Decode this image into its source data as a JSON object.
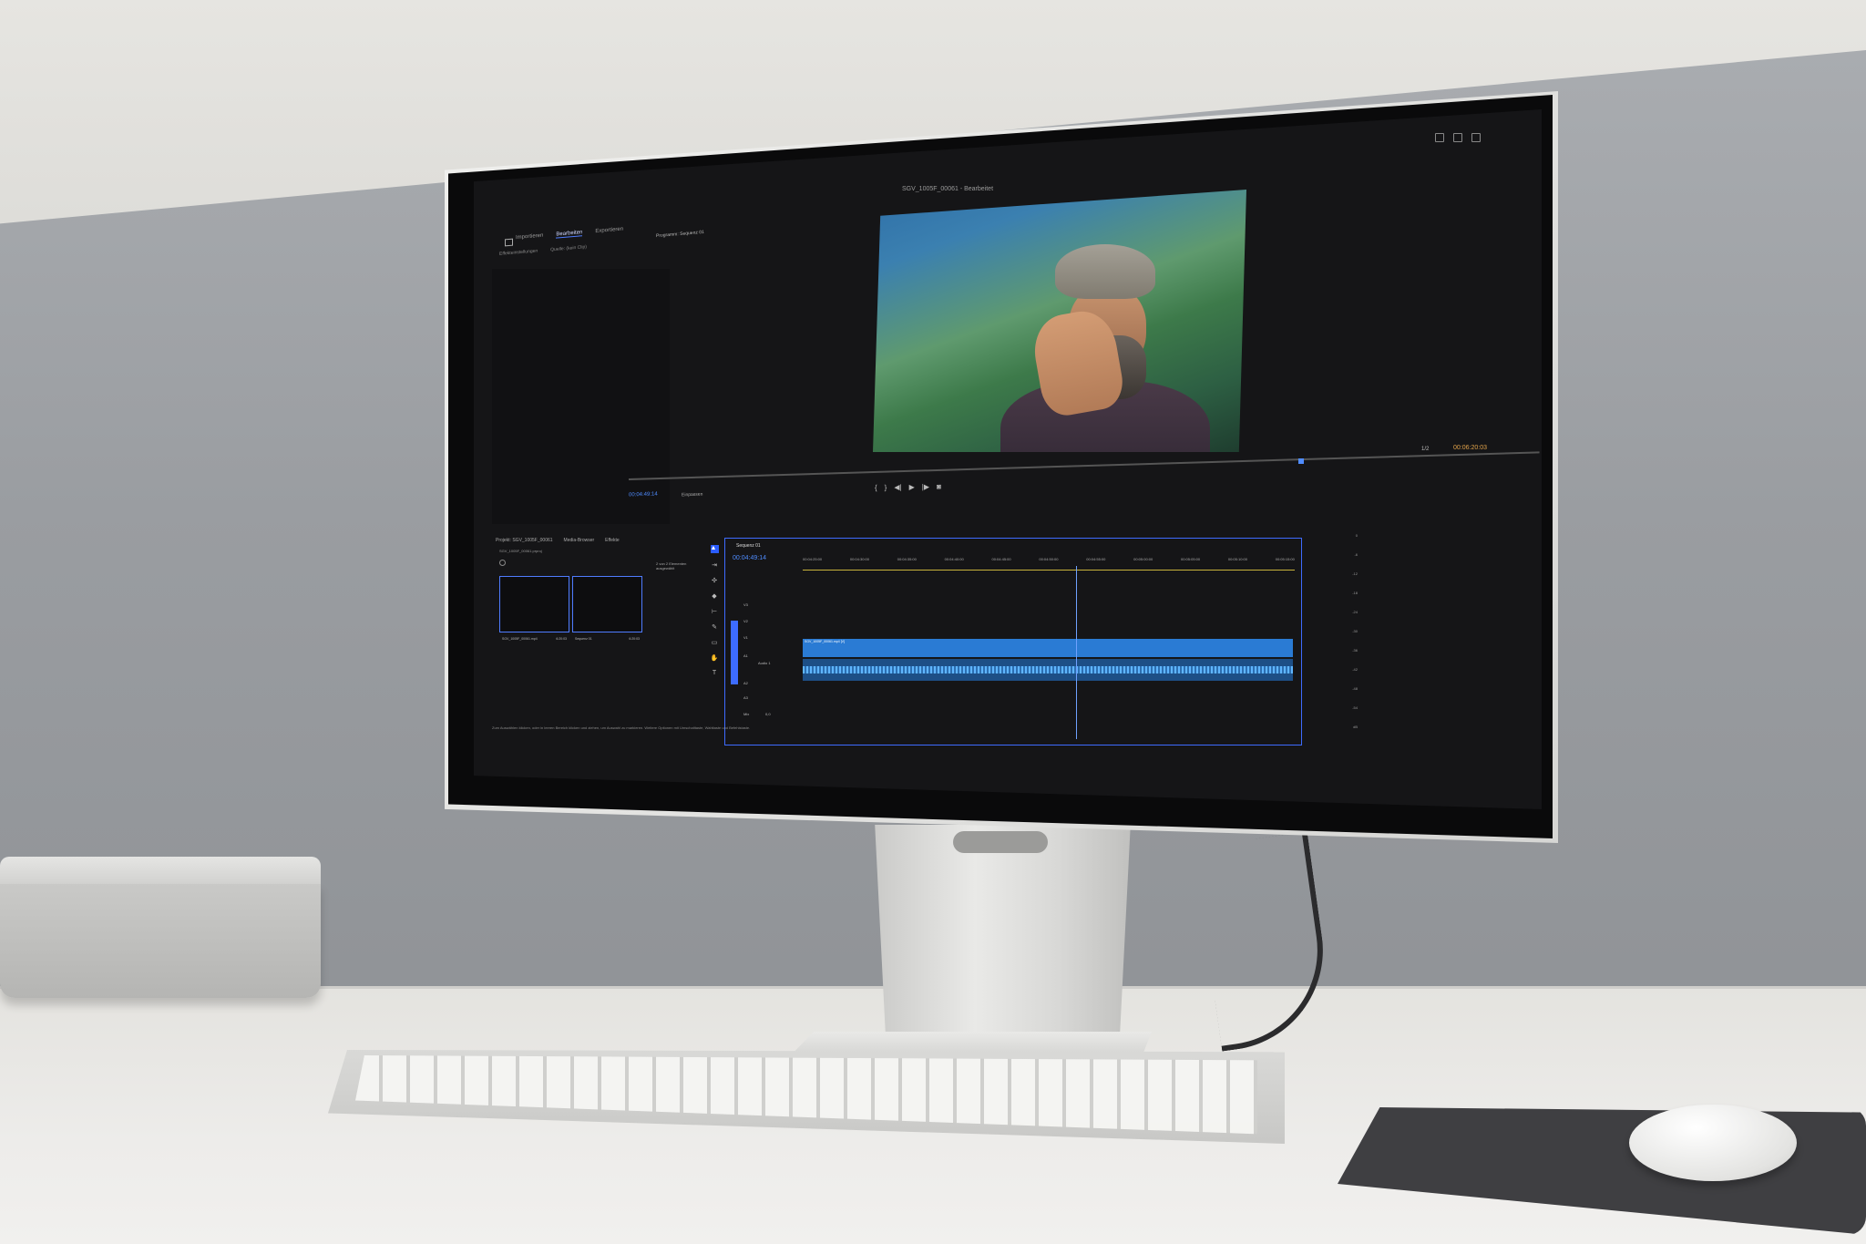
{
  "scene": "desk-setup",
  "editor": {
    "window_title": "SGV_1005F_00061 - Bearbeitet",
    "workspace_tabs": [
      "Importieren",
      "Bearbeiten",
      "Exportieren"
    ],
    "active_tab": "Bearbeiten",
    "sub_tabs": [
      "Effekteinstellungen",
      "Quelle: (kein Clip)"
    ],
    "program_monitor_label": "Programm: Sequenz 01",
    "program_timecode": "00:06:20:03",
    "program_fraction": "1/2",
    "playhead_timecode": "00:04:49:14",
    "fit_dropdown": "Einpassen",
    "project": {
      "tabs": [
        "Projekt: SGV_1005F_00061",
        "Media-Browser",
        "Effekte"
      ],
      "project_file": "SGV_1005F_00061.prproj",
      "selection_info": "2 von 2 Elementen ausgewählt",
      "items": [
        {
          "name": "SGV_1005F_00061.mp4",
          "duration": "6:20:03"
        },
        {
          "name": "Sequenz 01",
          "duration": "6:20:03"
        }
      ]
    },
    "timeline": {
      "sequence_name": "Sequenz 01",
      "timecode": "00:04:49:14",
      "ruler_ticks": [
        "00:04:25:00",
        "00:04:30:00",
        "00:04:35:00",
        "00:04:40:00",
        "00:04:45:00",
        "00:04:50:00",
        "00:04:55:00",
        "00:05:00:00",
        "00:05:05:00",
        "00:05:10:00",
        "00:05:15:00"
      ],
      "tracks": [
        "V3",
        "V2",
        "V1",
        "A1",
        "A2",
        "A3",
        "Mix"
      ],
      "audio_track_label": "Audio 1",
      "video_clip": "SGV_1005F_00061.mp4 [V]",
      "mix_value": "0,0"
    },
    "meter_scale": [
      "0",
      "-6",
      "-12",
      "-18",
      "-24",
      "-30",
      "-36",
      "-42",
      "-48",
      "-54",
      "dB"
    ],
    "status_bar": "Zum Auswählen klicken, oder in leeren Bereich klicken und ziehen, um Auswahl zu markieren. Weitere Optionen mit Umschalttaste, Wahltaste und Befehlstaste."
  },
  "colors": {
    "accent": "#3e6bff",
    "timecode": "#4f8cff",
    "video_clip": "#2a7bd4",
    "audio_clip": "#1d4f86"
  }
}
